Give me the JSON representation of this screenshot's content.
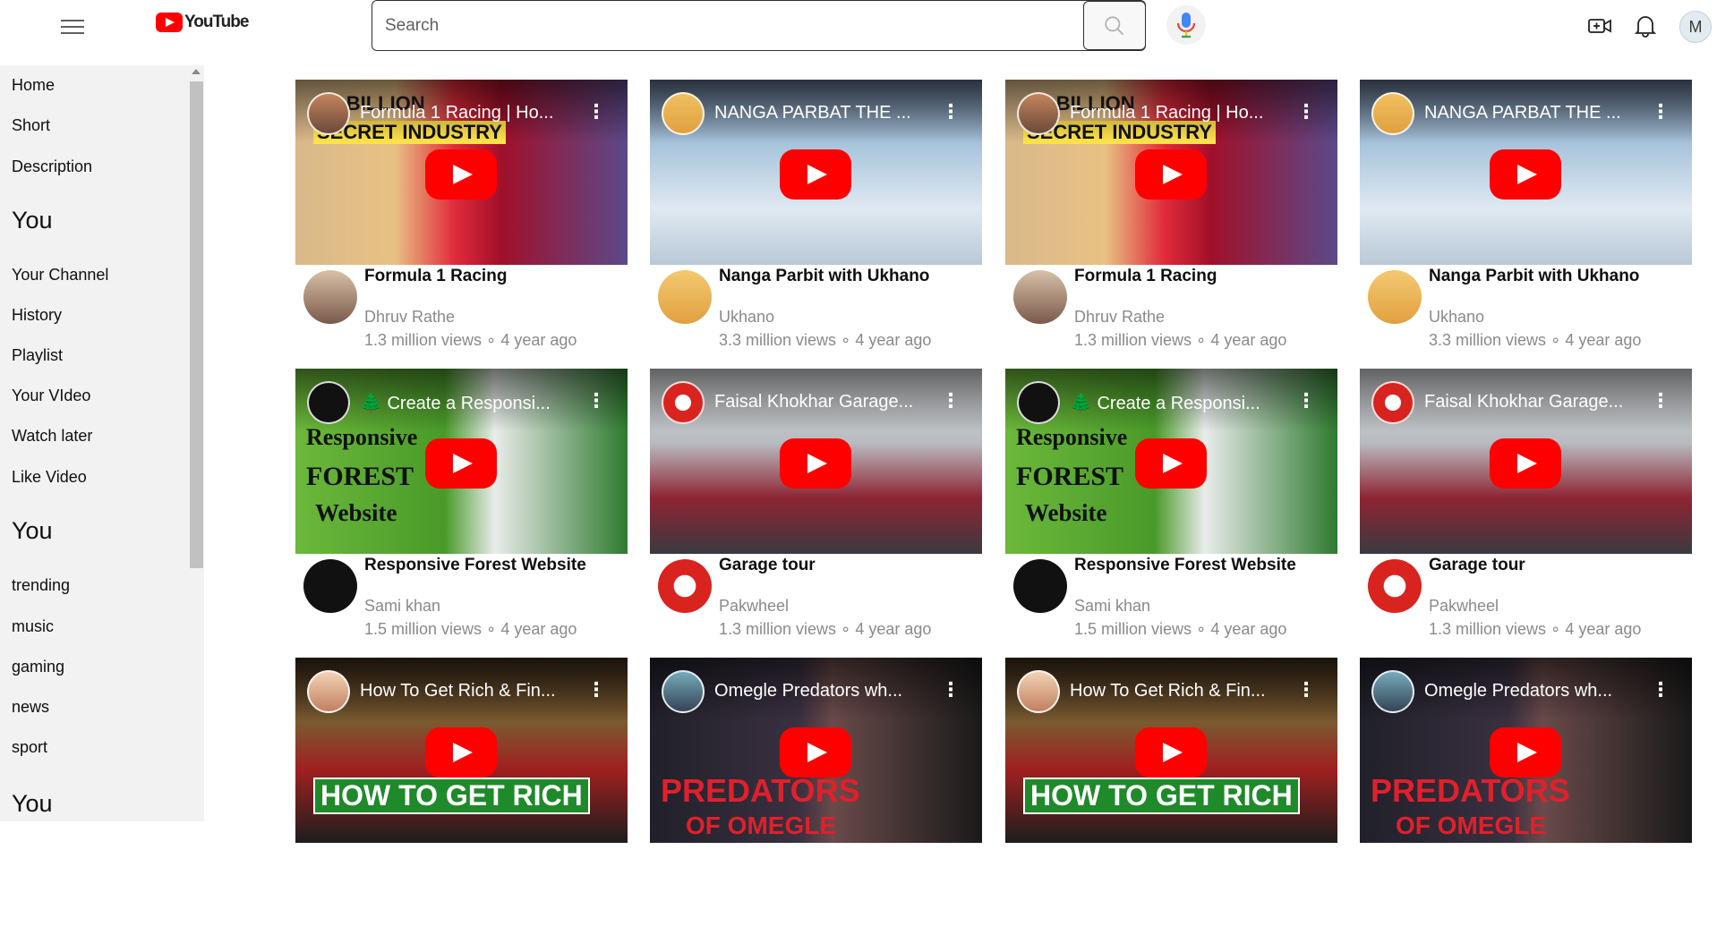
{
  "header": {
    "logo_text": "YouTube",
    "search_placeholder": "Search",
    "avatar_initial": "M"
  },
  "sidebar": {
    "items_top": [
      "Home",
      "Short",
      "Description"
    ],
    "section1_heading": "You",
    "items_you": [
      "Your Channel",
      "History",
      "Playlist",
      "Your VIdeo",
      "Watch later",
      "Like Video"
    ],
    "section2_heading": "You",
    "items_explore": [
      "trending",
      "music",
      "gaming",
      "news",
      "sport"
    ],
    "section3_heading": "You"
  },
  "videos": [
    {
      "thumb_title": "Formula 1 Racing | Ho...",
      "title": "Formula 1 Racing",
      "channel": "Dhruv Rathe",
      "stats": "1.3 million views ∘ 4 year ago",
      "theme": "f1",
      "thumb_text_1": "1.3 BILLION",
      "thumb_text_2": "SECRET INDUSTRY"
    },
    {
      "thumb_title": "NANGA PARBAT THE ...",
      "title": "Nanga Parbit with Ukhano",
      "channel": "Ukhano",
      "stats": "3.3 million views ∘ 4 year ago",
      "theme": "mountain"
    },
    {
      "thumb_title": "Formula 1 Racing | Ho...",
      "title": "Formula 1 Racing",
      "channel": "Dhruv Rathe",
      "stats": "1.3 million views ∘ 4 year ago",
      "theme": "f1",
      "thumb_text_1": "1.3 BILLION",
      "thumb_text_2": "SECRET INDUSTRY"
    },
    {
      "thumb_title": "NANGA PARBAT THE ...",
      "title": "Nanga Parbit with Ukhano",
      "channel": "Ukhano",
      "stats": "3.3 million views ∘ 4 year ago",
      "theme": "mountain"
    },
    {
      "thumb_title": "🌲 Create a Responsi...",
      "title": "Responsive Forest Website",
      "channel": "Sami khan",
      "stats": "1.5 million views ∘ 4 year ago",
      "theme": "forest",
      "thumb_text_1": "Responsive",
      "thumb_text_2": "FOREST",
      "thumb_text_3": "Website"
    },
    {
      "thumb_title": "Faisal Khokhar Garage...",
      "title": "Garage tour",
      "channel": "Pakwheel",
      "stats": "1.3 million views ∘ 4 year ago",
      "theme": "garage"
    },
    {
      "thumb_title": "🌲 Create a Responsi...",
      "title": "Responsive Forest Website",
      "channel": "Sami khan",
      "stats": "1.5 million views ∘ 4 year ago",
      "theme": "forest",
      "thumb_text_1": "Responsive",
      "thumb_text_2": "FOREST",
      "thumb_text_3": "Website"
    },
    {
      "thumb_title": "Faisal Khokhar Garage...",
      "title": "Garage tour",
      "channel": "Pakwheel",
      "stats": "1.3 million views ∘ 4 year ago",
      "theme": "garage"
    },
    {
      "thumb_title": "How To Get Rich & Fin...",
      "title": "",
      "channel": "",
      "stats": "",
      "theme": "rich",
      "thumb_text_1": "HOW TO GET RICH"
    },
    {
      "thumb_title": "Omegle Predators wh...",
      "title": "",
      "channel": "",
      "stats": "",
      "theme": "omegle",
      "thumb_text_1": "PREDATORS",
      "thumb_text_2": "OF OMEGLE"
    },
    {
      "thumb_title": "How To Get Rich & Fin...",
      "title": "",
      "channel": "",
      "stats": "",
      "theme": "rich",
      "thumb_text_1": "HOW TO GET RICH"
    },
    {
      "thumb_title": "Omegle Predators wh...",
      "title": "",
      "channel": "",
      "stats": "",
      "theme": "omegle",
      "thumb_text_1": "PREDATORS",
      "thumb_text_2": "OF OMEGLE"
    }
  ],
  "colors": {
    "accent": "#ff0000",
    "sidebar_bg": "#f2f2f2",
    "meta_text": "#8a8a8a"
  }
}
